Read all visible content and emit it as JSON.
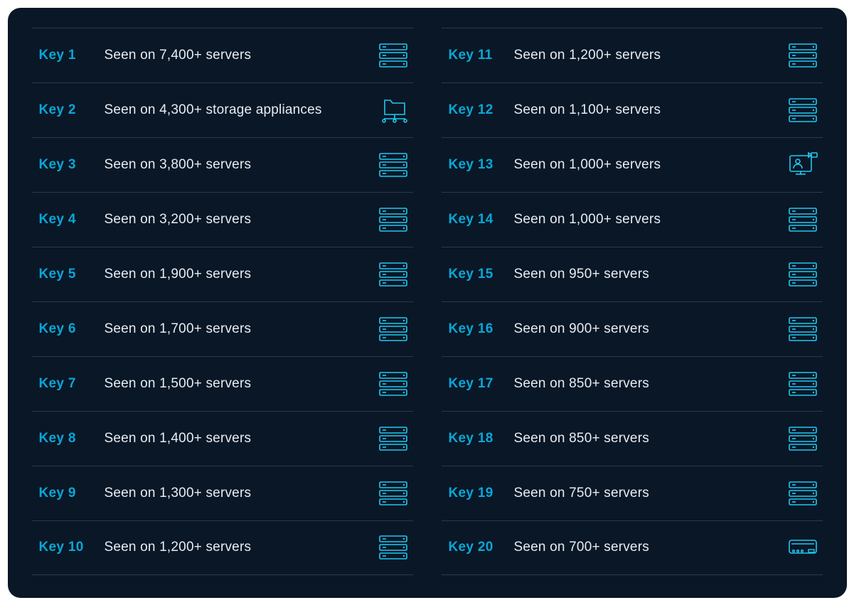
{
  "columns": [
    {
      "rows": [
        {
          "key": "Key 1",
          "desc": "Seen on 7,400+ servers",
          "icon": "server"
        },
        {
          "key": "Key 2",
          "desc": "Seen on 4,300+ storage appliances",
          "icon": "storage"
        },
        {
          "key": "Key 3",
          "desc": "Seen on 3,800+ servers",
          "icon": "server"
        },
        {
          "key": "Key 4",
          "desc": "Seen on 3,200+ servers",
          "icon": "server"
        },
        {
          "key": "Key 5",
          "desc": "Seen on 1,900+ servers",
          "icon": "server"
        },
        {
          "key": "Key 6",
          "desc": "Seen on 1,700+ servers",
          "icon": "server"
        },
        {
          "key": "Key 7",
          "desc": "Seen on 1,500+ servers",
          "icon": "server"
        },
        {
          "key": "Key 8",
          "desc": "Seen on 1,400+ servers",
          "icon": "server"
        },
        {
          "key": "Key 9",
          "desc": "Seen on 1,300+ servers",
          "icon": "server"
        },
        {
          "key": "Key 10",
          "desc": "Seen on 1,200+ servers",
          "icon": "server"
        }
      ]
    },
    {
      "rows": [
        {
          "key": "Key 11",
          "desc": "Seen on 1,200+ servers",
          "icon": "server"
        },
        {
          "key": "Key 12",
          "desc": "Seen on 1,100+ servers",
          "icon": "server"
        },
        {
          "key": "Key 13",
          "desc": "Seen on 1,000+ servers",
          "icon": "video"
        },
        {
          "key": "Key 14",
          "desc": "Seen on 1,000+ servers",
          "icon": "server"
        },
        {
          "key": "Key 15",
          "desc": "Seen on 950+ servers",
          "icon": "server"
        },
        {
          "key": "Key 16",
          "desc": "Seen on 900+ servers",
          "icon": "server"
        },
        {
          "key": "Key 17",
          "desc": "Seen on 850+ servers",
          "icon": "server"
        },
        {
          "key": "Key 18",
          "desc": "Seen on 850+ servers",
          "icon": "server"
        },
        {
          "key": "Key 19",
          "desc": "Seen on 750+ servers",
          "icon": "server"
        },
        {
          "key": "Key 20",
          "desc": "Seen on 700+ servers",
          "icon": "device"
        }
      ]
    }
  ],
  "colors": {
    "accent": "#09a7d7",
    "background": "#0a1726",
    "text": "#e6edf3",
    "border": "#2a3a4a",
    "iconStroke": "#1ec9f2"
  }
}
